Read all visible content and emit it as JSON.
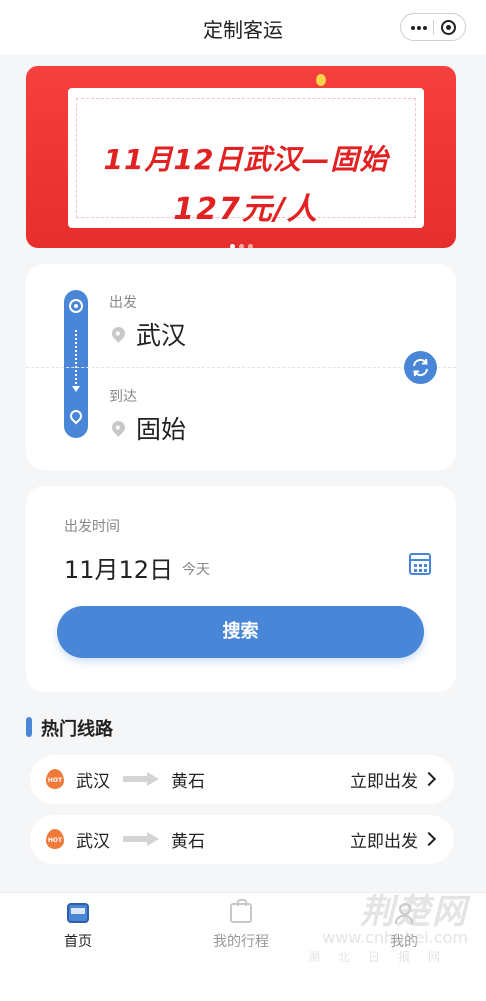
{
  "header": {
    "title": "定制客运"
  },
  "banner": {
    "line1": "11月12日武汉—固始",
    "line2": "127元/人"
  },
  "route": {
    "depart_label": "出发",
    "depart_city": "武汉",
    "arrive_label": "到达",
    "arrive_city": "固始"
  },
  "date": {
    "label": "出发时间",
    "value": "11月12日",
    "today": "今天",
    "search_label": "搜索"
  },
  "hot": {
    "title": "热门线路",
    "badge": "HOT",
    "items": [
      {
        "from": "武汉",
        "to": "黄石",
        "action": "立即出发"
      },
      {
        "from": "武汉",
        "to": "黄石",
        "action": "立即出发"
      }
    ]
  },
  "tabbar": {
    "home": "首页",
    "trips": "我的行程",
    "mine": "我的"
  },
  "watermark": {
    "brand": "荆楚网",
    "url": "www.cnhubei.com",
    "sub": "湖北日报网"
  },
  "colors": {
    "accent": "#4a86d8",
    "banner_red": "#e62e2c",
    "hot_orange": "#f07a3a"
  }
}
